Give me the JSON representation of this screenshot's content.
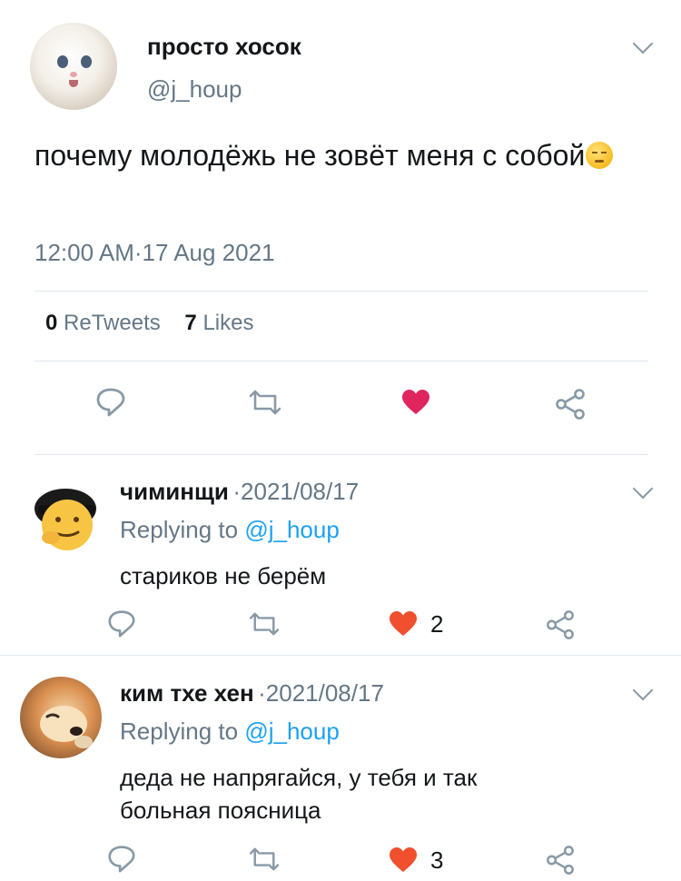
{
  "tweet": {
    "author_name": "просто хосок",
    "author_handle": "@j_houp",
    "text": "почему молодёжь не зовёт меня с собой",
    "timestamp": "12:00 AM·17 Aug 2021",
    "retweets_count": "0",
    "retweets_label": "ReTweets",
    "likes_count": "7",
    "likes_label": "Likes"
  },
  "replies": [
    {
      "author_name": "чиминщи",
      "date": "·2021/08/17",
      "replying_prefix": "Replying to",
      "replying_handle": "@j_houp",
      "text": "стариков не берём",
      "like_count": "2"
    },
    {
      "author_name": "ким тхе хен",
      "date": "·2021/08/17",
      "replying_prefix": "Replying to",
      "replying_handle": "@j_houp",
      "text": "деда не напрягайся, у тебя и так больная поясница",
      "like_count": "3"
    }
  ],
  "colors": {
    "like_red": "#e0245e",
    "link_blue": "#1da1f2",
    "secondary_gray": "#657786",
    "icon_gray": "#8899a6"
  },
  "icons": [
    "reply-icon",
    "retweet-icon",
    "like-icon",
    "share-icon",
    "chevron-down-icon"
  ]
}
